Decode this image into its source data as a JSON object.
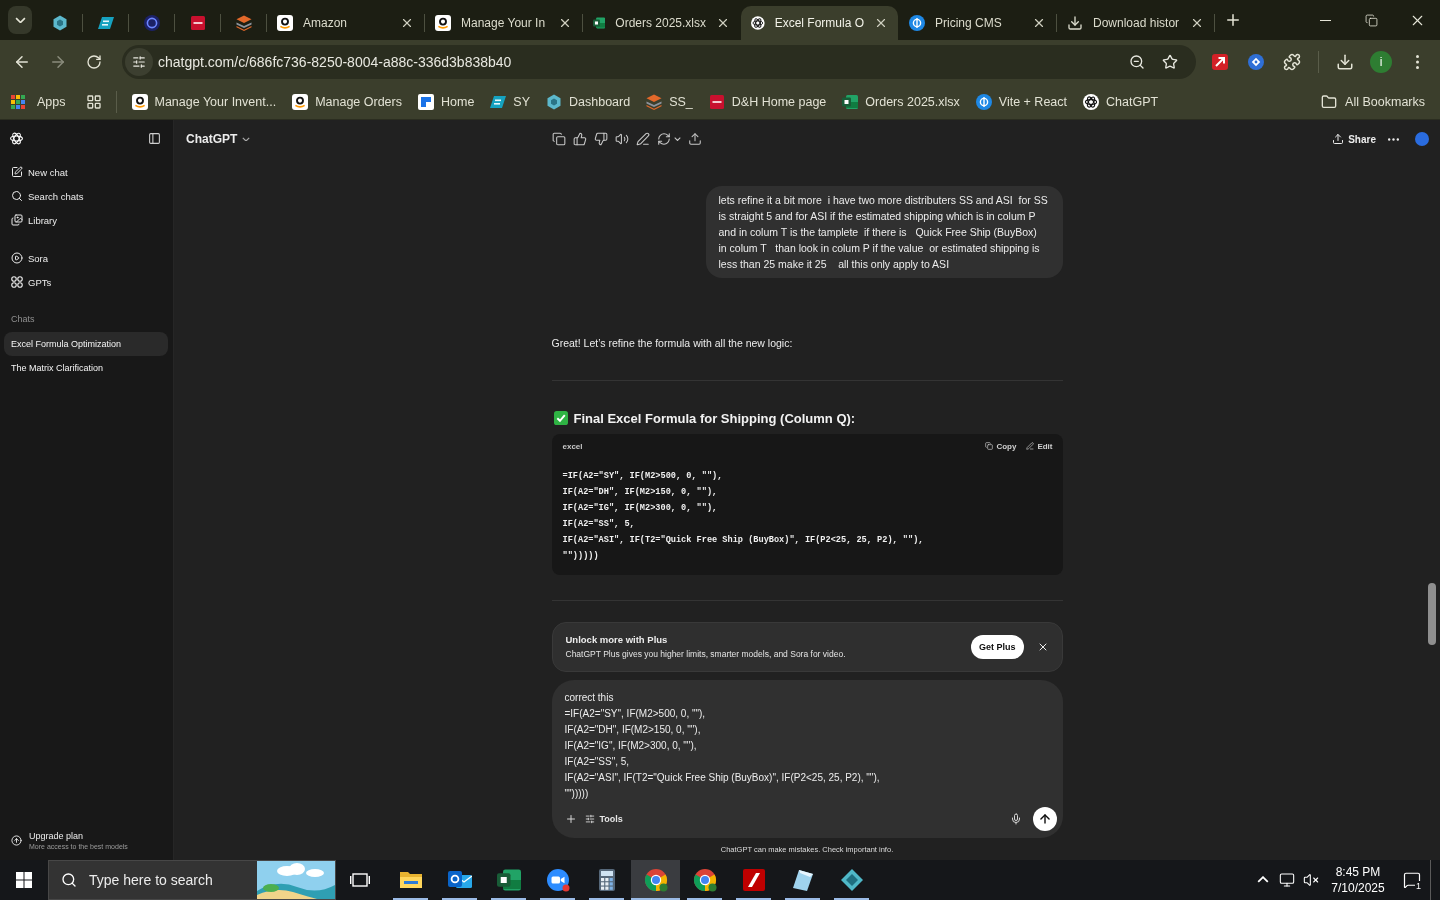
{
  "browser": {
    "tabs": [
      {
        "selected": false
      },
      {
        "selected": false
      },
      {
        "selected": false
      },
      {
        "selected": false
      },
      {
        "selected": false
      },
      {
        "title": "Amazon",
        "selected": false
      },
      {
        "title": "Manage Your In",
        "selected": false
      },
      {
        "title": "Orders 2025.xlsx",
        "selected": false
      },
      {
        "title": "Excel Formula O",
        "selected": true
      },
      {
        "title": "Pricing CMS",
        "selected": false
      },
      {
        "title": "Download histor",
        "selected": false
      }
    ],
    "address": "chatgpt.com/c/686fc736-8250-8004-a88c-336d3b838b40",
    "profile_initial": "i",
    "apps": "Apps",
    "bookmarks": [
      "Manage Your Invent...",
      "Manage Orders",
      "Home",
      "SY",
      "Dashboard",
      "SS_",
      "D&H Home page",
      "Orders 2025.xlsx",
      "Vite + React",
      "ChatGPT"
    ],
    "all_bookmarks": "All Bookmarks"
  },
  "sidebar": {
    "actions": [
      "New chat",
      "Search chats",
      "Library"
    ],
    "extras": [
      "Sora",
      "GPTs"
    ],
    "section_title": "Chats",
    "chats": [
      {
        "title": "Excel Formula Optimization",
        "selected": true
      },
      {
        "title": "The Matrix Clarification",
        "selected": false
      }
    ],
    "upgrade": {
      "title": "Upgrade plan",
      "subtitle": "More access to the best models"
    }
  },
  "header": {
    "model": "ChatGPT",
    "share": "Share"
  },
  "conversation": {
    "user_message": "lets refine it a bit more  i have two more distributers SS and ASI  for SS is straight 5 and for ASI if the estimated shipping which is in colum P and in colum T is the tamplete  if there is   Quick Free Ship (BuyBox)  in colum T   than look in colum P if the value  or estimated shipping is less than 25 make it 25    all this only apply to ASI",
    "intro": "Great! Let’s refine the formula with all the new logic:",
    "heading": "Final Excel Formula for Shipping (Column Q):",
    "code": {
      "language": "excel",
      "copy": "Copy",
      "edit": "Edit",
      "lines": [
        "=IF(A2=\"SY\", IF(M2>500, 0, \"\"),",
        "IF(A2=\"DH\", IF(M2>150, 0, \"\"),",
        "IF(A2=\"IG\", IF(M2>300, 0, \"\"),",
        "IF(A2=\"SS\", 5,",
        "IF(A2=\"ASI\", IF(T2=\"Quick Free Ship (BuyBox)\", IF(P2<25, 25, P2), \"\"),",
        "\"\")))))"
      ]
    }
  },
  "upsell": {
    "title": "Unlock more with Plus",
    "text": "ChatGPT Plus gives you higher limits, smarter models, and Sora for video.",
    "button": "Get Plus"
  },
  "composer": {
    "value": "correct this\n=IF(A2=\"SY\", IF(M2>500, 0, \"\"),\nIF(A2=\"DH\", IF(M2>150, 0, \"\"),\nIF(A2=\"IG\", IF(M2>300, 0, \"\"),\nIF(A2=\"SS\", 5,\nIF(A2=\"ASI\", IF(T2=\"Quick Free Ship (BuyBox)\", IF(P2<25, 25, P2), \"\"),\n\"\")))))",
    "tools": "Tools"
  },
  "disclaimer": "ChatGPT can make mistakes. Check important info.",
  "taskbar": {
    "search_placeholder": "Type here to search",
    "apps": [
      {
        "selected": false
      },
      {
        "selected": false
      },
      {
        "selected": false
      },
      {
        "selected": false
      },
      {
        "selected": false
      },
      {
        "selected": true
      },
      {
        "selected": false
      },
      {
        "selected": false
      },
      {
        "selected": false
      },
      {
        "selected": false
      }
    ],
    "time": "8:45 PM",
    "date": "7/10/2025",
    "notification_count": "1"
  }
}
